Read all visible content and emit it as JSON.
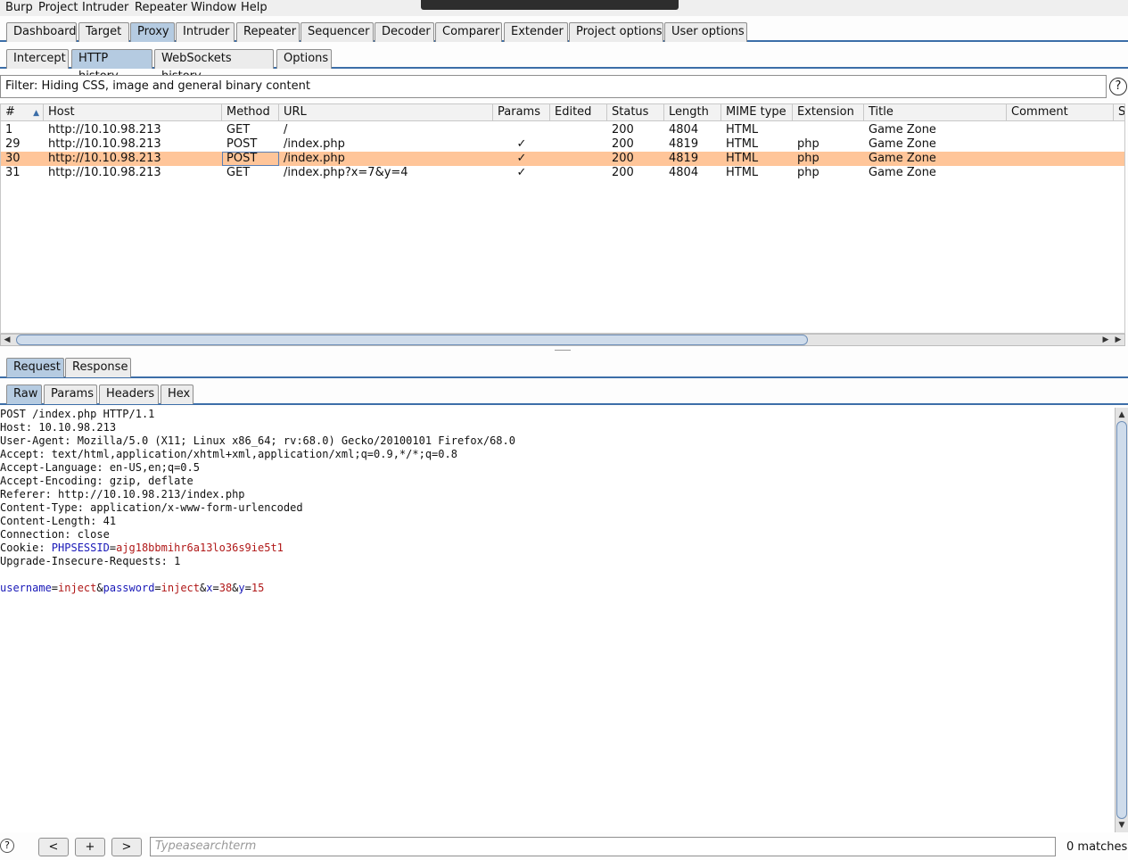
{
  "menu": [
    "Burp",
    "Project",
    "Intruder",
    "Repeater",
    "Window",
    "Help"
  ],
  "main_tabs": [
    "Dashboard",
    "Target",
    "Proxy",
    "Intruder",
    "Repeater",
    "Sequencer",
    "Decoder",
    "Comparer",
    "Extender",
    "Project options",
    "User options"
  ],
  "main_tab_active": "Proxy",
  "proxy_tabs": [
    "Intercept",
    "HTTP history",
    "WebSockets history",
    "Options"
  ],
  "proxy_tab_active": "HTTP history",
  "filter_text": "Filter: Hiding CSS, image and general binary content",
  "help_glyph": "?",
  "table": {
    "columns": [
      "#",
      "Host",
      "Method",
      "URL",
      "Params",
      "Edited",
      "Status",
      "Length",
      "MIME type",
      "Extension",
      "Title",
      "Comment",
      "S"
    ],
    "rows": [
      {
        "num": "1",
        "host": "http://10.10.98.213",
        "method": "GET",
        "url": "/",
        "params": "",
        "edited": "",
        "status": "200",
        "length": "4804",
        "mime": "HTML",
        "ext": "",
        "title": "Game Zone",
        "comment": ""
      },
      {
        "num": "29",
        "host": "http://10.10.98.213",
        "method": "POST",
        "url": "/index.php",
        "params": "✓",
        "edited": "",
        "status": "200",
        "length": "4819",
        "mime": "HTML",
        "ext": "php",
        "title": "Game Zone",
        "comment": ""
      },
      {
        "num": "30",
        "host": "http://10.10.98.213",
        "method": "POST",
        "url": "/index.php",
        "params": "✓",
        "edited": "",
        "status": "200",
        "length": "4819",
        "mime": "HTML",
        "ext": "php",
        "title": "Game Zone",
        "comment": ""
      },
      {
        "num": "31",
        "host": "http://10.10.98.213",
        "method": "GET",
        "url": "/index.php?x=7&y=4",
        "params": "✓",
        "edited": "",
        "status": "200",
        "length": "4804",
        "mime": "HTML",
        "ext": "php",
        "title": "Game Zone",
        "comment": ""
      }
    ],
    "selected_row": "30"
  },
  "message_tabs": [
    "Request",
    "Response"
  ],
  "message_tab_active": "Request",
  "view_tabs": [
    "Raw",
    "Params",
    "Headers",
    "Hex"
  ],
  "view_tab_active": "Raw",
  "request": {
    "lines": [
      "POST /index.php HTTP/1.1",
      "Host: 10.10.98.213",
      "User-Agent: Mozilla/5.0 (X11; Linux x86_64; rv:68.0) Gecko/20100101 Firefox/68.0",
      "Accept: text/html,application/xhtml+xml,application/xml;q=0.9,*/*;q=0.8",
      "Accept-Language: en-US,en;q=0.5",
      "Accept-Encoding: gzip, deflate",
      "Referer: http://10.10.98.213/index.php",
      "Content-Type: application/x-www-form-urlencoded",
      "Content-Length: 41",
      "Connection: close"
    ],
    "cookie_label": "Cookie: ",
    "cookie_name": "PHPSESSID",
    "cookie_value": "ajg18bbmihr6a13lo36s9ie5t1",
    "upgrade_line": "Upgrade-Insecure-Requests: 1",
    "body_params": [
      {
        "name": "username",
        "value": "inject"
      },
      {
        "name": "password",
        "value": "inject"
      },
      {
        "name": "x",
        "value": "38"
      },
      {
        "name": "y",
        "value": "15"
      }
    ]
  },
  "bottom": {
    "prev": "<",
    "add": "+",
    "next": ">",
    "search_placeholder": "Typeasearchterm",
    "matches": "0 matches"
  },
  "colors": {
    "accent": "#3c6ea8",
    "active_tab": "#b5cbe1",
    "selected_row": "#ffc599",
    "param_name": "#1a1ab8",
    "param_value": "#b01818"
  }
}
